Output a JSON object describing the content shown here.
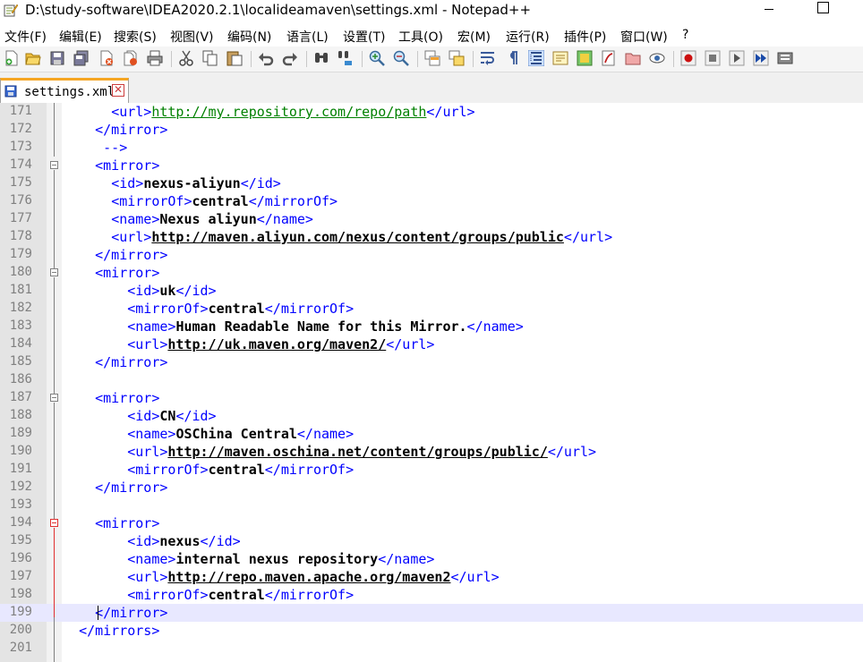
{
  "window": {
    "title": "D:\\study-software\\IDEA2020.2.1\\localideamaven\\settings.xml - Notepad++"
  },
  "menu": [
    "文件(F)",
    "编辑(E)",
    "搜索(S)",
    "视图(V)",
    "编码(N)",
    "语言(L)",
    "设置(T)",
    "工具(O)",
    "宏(M)",
    "运行(R)",
    "插件(P)",
    "窗口(W)",
    "?"
  ],
  "toolbar": {
    "icons": [
      "new-file-icon",
      "open-file-icon",
      "save-icon",
      "save-all-icon",
      "close-icon",
      "close-all-icon",
      "print-icon",
      "cut-icon",
      "copy-icon",
      "paste-icon",
      "undo-icon",
      "redo-icon",
      "find-icon",
      "replace-icon",
      "zoom-in-icon",
      "zoom-out-icon",
      "sync-vertical-icon",
      "sync-horizontal-icon",
      "word-wrap-icon",
      "show-all-chars-icon",
      "indent-guide-icon",
      "document-map-icon",
      "function-list-icon",
      "folder-workspace-icon",
      "monitoring-icon",
      "record-macro-icon",
      "stop-record-icon",
      "playback-icon",
      "run-multiple-icon",
      "save-macro-icon"
    ]
  },
  "tab": {
    "label": "settings.xml"
  },
  "editor": {
    "current_line": 199,
    "lines": [
      {
        "n": "171",
        "indent": "      ",
        "parts": [
          [
            "tg",
            "<url>"
          ],
          [
            "urlg",
            "http://my.repository.com/repo/path"
          ],
          [
            "tg",
            "</url>"
          ]
        ]
      },
      {
        "n": "172",
        "indent": "    ",
        "parts": [
          [
            "tg",
            "</mirror>"
          ]
        ]
      },
      {
        "n": "173",
        "indent": "     ",
        "parts": [
          [
            "tg",
            "-->"
          ]
        ]
      },
      {
        "n": "174",
        "indent": "    ",
        "parts": [
          [
            "tg",
            "<mirror>"
          ]
        ]
      },
      {
        "n": "175",
        "indent": "      ",
        "parts": [
          [
            "tg",
            "<id>"
          ],
          [
            "txt",
            "nexus-aliyun"
          ],
          [
            "tg",
            "</id>"
          ]
        ]
      },
      {
        "n": "176",
        "indent": "      ",
        "parts": [
          [
            "tg",
            "<mirrorOf>"
          ],
          [
            "txt",
            "central"
          ],
          [
            "tg",
            "</mirrorOf>"
          ]
        ]
      },
      {
        "n": "177",
        "indent": "      ",
        "parts": [
          [
            "tg",
            "<name>"
          ],
          [
            "txt",
            "Nexus aliyun"
          ],
          [
            "tg",
            "</name>"
          ]
        ]
      },
      {
        "n": "178",
        "indent": "      ",
        "parts": [
          [
            "tg",
            "<url>"
          ],
          [
            "url",
            "http://maven.aliyun.com/nexus/content/groups/public"
          ],
          [
            "tg",
            "</url>"
          ]
        ]
      },
      {
        "n": "179",
        "indent": "    ",
        "parts": [
          [
            "tg",
            "</mirror>"
          ]
        ]
      },
      {
        "n": "180",
        "indent": "    ",
        "parts": [
          [
            "tg",
            "<mirror>"
          ]
        ]
      },
      {
        "n": "181",
        "indent": "        ",
        "parts": [
          [
            "tg",
            "<id>"
          ],
          [
            "txt",
            "uk"
          ],
          [
            "tg",
            "</id>"
          ]
        ]
      },
      {
        "n": "182",
        "indent": "        ",
        "parts": [
          [
            "tg",
            "<mirrorOf>"
          ],
          [
            "txt",
            "central"
          ],
          [
            "tg",
            "</mirrorOf>"
          ]
        ]
      },
      {
        "n": "183",
        "indent": "        ",
        "parts": [
          [
            "tg",
            "<name>"
          ],
          [
            "txt",
            "Human Readable Name for this Mirror."
          ],
          [
            "tg",
            "</name>"
          ]
        ]
      },
      {
        "n": "184",
        "indent": "        ",
        "parts": [
          [
            "tg",
            "<url>"
          ],
          [
            "url",
            "http://uk.maven.org/maven2/"
          ],
          [
            "tg",
            "</url>"
          ]
        ]
      },
      {
        "n": "185",
        "indent": "    ",
        "parts": [
          [
            "tg",
            "</mirror>"
          ]
        ]
      },
      {
        "n": "186",
        "indent": "",
        "parts": []
      },
      {
        "n": "187",
        "indent": "    ",
        "parts": [
          [
            "tg",
            "<mirror>"
          ]
        ]
      },
      {
        "n": "188",
        "indent": "        ",
        "parts": [
          [
            "tg",
            "<id>"
          ],
          [
            "txt",
            "CN"
          ],
          [
            "tg",
            "</id>"
          ]
        ]
      },
      {
        "n": "189",
        "indent": "        ",
        "parts": [
          [
            "tg",
            "<name>"
          ],
          [
            "txt",
            "OSChina Central"
          ],
          [
            "tg",
            "</name>"
          ]
        ]
      },
      {
        "n": "190",
        "indent": "        ",
        "parts": [
          [
            "tg",
            "<url>"
          ],
          [
            "url",
            "http://maven.oschina.net/content/groups/public/"
          ],
          [
            "tg",
            "</url>"
          ]
        ]
      },
      {
        "n": "191",
        "indent": "        ",
        "parts": [
          [
            "tg",
            "<mirrorOf>"
          ],
          [
            "txt",
            "central"
          ],
          [
            "tg",
            "</mirrorOf>"
          ]
        ]
      },
      {
        "n": "192",
        "indent": "    ",
        "parts": [
          [
            "tg",
            "</mirror>"
          ]
        ]
      },
      {
        "n": "193",
        "indent": "",
        "parts": []
      },
      {
        "n": "194",
        "indent": "    ",
        "parts": [
          [
            "tg",
            "<mirror>"
          ]
        ]
      },
      {
        "n": "195",
        "indent": "        ",
        "parts": [
          [
            "tg",
            "<id>"
          ],
          [
            "txt",
            "nexus"
          ],
          [
            "tg",
            "</id>"
          ]
        ]
      },
      {
        "n": "196",
        "indent": "        ",
        "parts": [
          [
            "tg",
            "<name>"
          ],
          [
            "txt",
            "internal nexus repository"
          ],
          [
            "tg",
            "</name>"
          ]
        ]
      },
      {
        "n": "197",
        "indent": "        ",
        "parts": [
          [
            "tg",
            "<url>"
          ],
          [
            "url",
            "http://repo.maven.apache.org/maven2"
          ],
          [
            "tg",
            "</url>"
          ]
        ]
      },
      {
        "n": "198",
        "indent": "        ",
        "parts": [
          [
            "tg",
            "<mirrorOf>"
          ],
          [
            "txt",
            "central"
          ],
          [
            "tg",
            "</mirrorOf>"
          ]
        ]
      },
      {
        "n": "199",
        "indent": "    ",
        "parts": [
          [
            "tg",
            "</mirror>"
          ]
        ]
      },
      {
        "n": "200",
        "indent": "  ",
        "parts": [
          [
            "tg",
            "</mirrors>"
          ]
        ]
      },
      {
        "n": "201",
        "indent": "",
        "parts": []
      }
    ]
  }
}
